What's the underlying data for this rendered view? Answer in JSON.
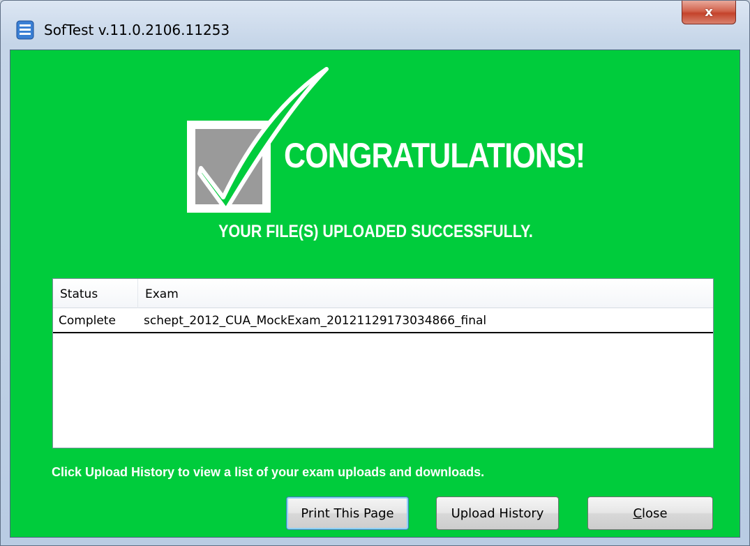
{
  "window": {
    "title": "SofTest v.11.0.2106.11253",
    "close_glyph": "x"
  },
  "banner": {
    "headline": "CONGRATULATIONS!",
    "subtitle": "YOUR FILE(S) UPLOADED SUCCESSFULLY.",
    "background_color": "#00cc3c"
  },
  "uploads_table": {
    "columns": [
      "Status",
      "Exam"
    ],
    "rows": [
      {
        "status": "Complete",
        "exam": "schept_2012_CUA_MockExam_20121129173034866_final"
      }
    ]
  },
  "hint": "Click Upload History to view a list of your exam uploads and downloads.",
  "buttons": {
    "print": "Print This Page",
    "history": "Upload History",
    "close_mnemonic": "C",
    "close_rest": "lose"
  },
  "icons": {
    "app": "softest-app-icon",
    "success": "checkmark-icon"
  }
}
